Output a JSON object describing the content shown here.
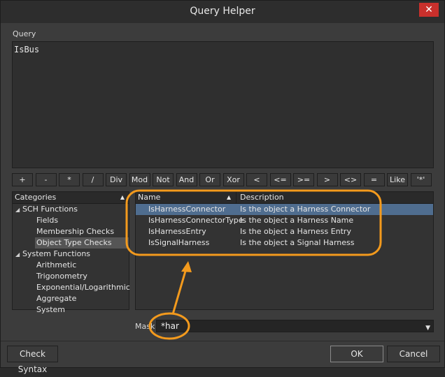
{
  "window": {
    "title": "Query Helper",
    "close_glyph": "✕"
  },
  "query": {
    "label": "Query",
    "value": "IsBus"
  },
  "operators": [
    "+",
    "-",
    "*",
    "/",
    "Div",
    "Mod",
    "Not",
    "And",
    "Or",
    "Xor",
    "<",
    "<=",
    ">=",
    ">",
    "<>",
    "=",
    "Like",
    "'*'"
  ],
  "categories": {
    "header": "Categories",
    "items": [
      {
        "label": "SCH Functions",
        "level": 0,
        "expanded": true
      },
      {
        "label": "Fields",
        "level": 1
      },
      {
        "label": "Membership Checks",
        "level": 1
      },
      {
        "label": "Object Type Checks",
        "level": 1,
        "selected": true
      },
      {
        "label": "System Functions",
        "level": 0,
        "expanded": true
      },
      {
        "label": "Arithmetic",
        "level": 1
      },
      {
        "label": "Trigonometry",
        "level": 1
      },
      {
        "label": "Exponential/Logarithmic",
        "level": 1
      },
      {
        "label": "Aggregate",
        "level": 1
      },
      {
        "label": "System",
        "level": 1
      }
    ]
  },
  "functions": {
    "col_name": "Name",
    "col_desc": "Description",
    "rows": [
      {
        "name": "IsHarnessConnector",
        "desc": "Is the object a Harness Connector",
        "selected": true
      },
      {
        "name": "IsHarnessConnectorType",
        "desc": "Is the object a Harness Name"
      },
      {
        "name": "IsHarnessEntry",
        "desc": "Is the object a Harness Entry"
      },
      {
        "name": "IsSignalHarness",
        "desc": "Is the object a Signal Harness"
      }
    ]
  },
  "mask": {
    "label": "Mask",
    "value": "*har"
  },
  "buttons": {
    "check_syntax": "Check Syntax",
    "ok": "OK",
    "cancel": "Cancel"
  },
  "colors": {
    "callout": "#f39a1d",
    "selection": "#4f6d8f",
    "close": "#c9302c"
  }
}
